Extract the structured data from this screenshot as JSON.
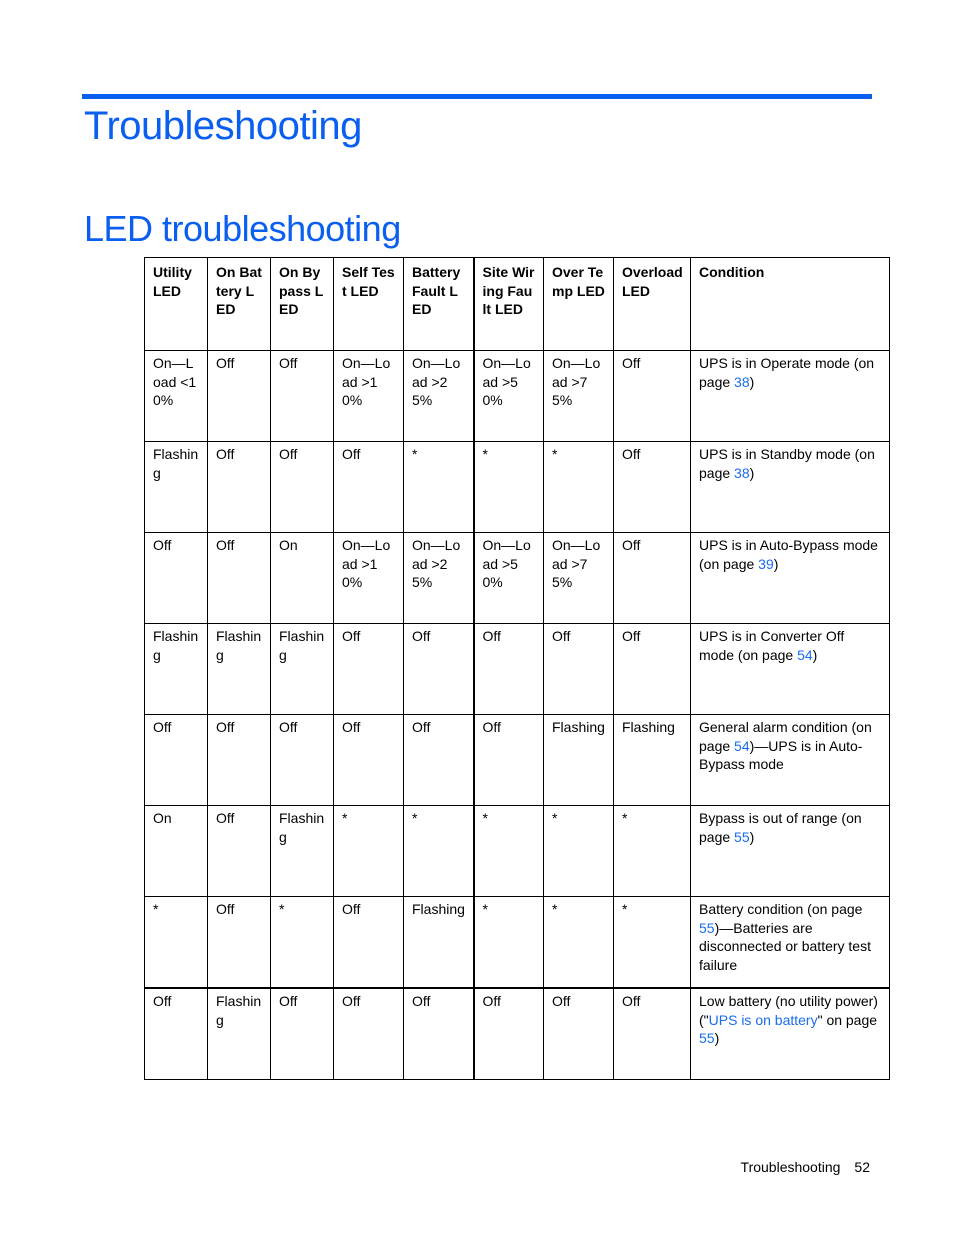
{
  "page": {
    "chapter_title": "Troubleshooting",
    "section_title": "LED troubleshooting"
  },
  "table": {
    "headers": [
      "Utility LED",
      "On Battery LED",
      "On Bypass LED",
      "Self Test LED",
      "Battery Fault LED",
      "Site Wiring Fault LED",
      "Over Temp LED",
      "Overload LED",
      "Condition"
    ],
    "rows": [
      {
        "cells": [
          "On—Load <10%",
          "Off",
          "Off",
          "On—Load >10%",
          "On—Load >25%",
          "On—Load >50%",
          "On—Load >75%",
          "Off"
        ],
        "condition": {
          "before": "UPS is in Operate mode (on page ",
          "link": "38",
          "after": ")"
        }
      },
      {
        "cells": [
          "Flashing",
          "Off",
          "Off",
          "Off",
          "*",
          "*",
          "*",
          "Off"
        ],
        "condition": {
          "before": "UPS is in Standby mode (on page ",
          "link": "38",
          "after": ")"
        }
      },
      {
        "cells": [
          "Off",
          "Off",
          "On",
          "On—Load >10%",
          "On—Load >25%",
          "On—Load >50%",
          "On—Load >75%",
          "Off"
        ],
        "condition": {
          "before": "UPS is in Auto-Bypass mode (on page ",
          "link": "39",
          "after": ")"
        }
      },
      {
        "cells": [
          "Flashing",
          "Flashing",
          "Flashing",
          "Off",
          "Off",
          "Off",
          "Off",
          "Off"
        ],
        "condition": {
          "before": "UPS is in Converter Off mode (on page ",
          "link": "54",
          "after": ")"
        }
      },
      {
        "cells": [
          "Off",
          "Off",
          "Off",
          "Off",
          "Off",
          "Off",
          "Flashing",
          "Flashing"
        ],
        "condition": {
          "before": "General alarm condition (on page ",
          "link": "54",
          "after": ")—UPS is in Auto-Bypass mode"
        }
      },
      {
        "cells": [
          "On",
          "Off",
          "Flashing",
          "*",
          "*",
          "*",
          "*",
          "*"
        ],
        "condition": {
          "before": "Bypass is out of range (on page ",
          "link": "55",
          "after": ")"
        }
      },
      {
        "cells": [
          "*",
          "Off",
          "*",
          "Off",
          "Flashing",
          "*",
          "*",
          "*"
        ],
        "condition": {
          "before": "Battery condition (on page ",
          "link": "55",
          "after": ")—Batteries are disconnected or battery test failure"
        }
      },
      {
        "cells": [
          "Off",
          "Flashing",
          "Off",
          "Off",
          "Off",
          "Off",
          "Off",
          "Off"
        ],
        "condition": {
          "before": "Low battery (no utility power) (\"",
          "link": "UPS is on battery",
          "middle": "\" on page ",
          "link2": "55",
          "after": ")"
        }
      }
    ]
  },
  "footer": {
    "section": "Troubleshooting",
    "page_number": "52"
  },
  "colors": {
    "heading": "#0a5ef0",
    "link": "#1a6cf0"
  }
}
